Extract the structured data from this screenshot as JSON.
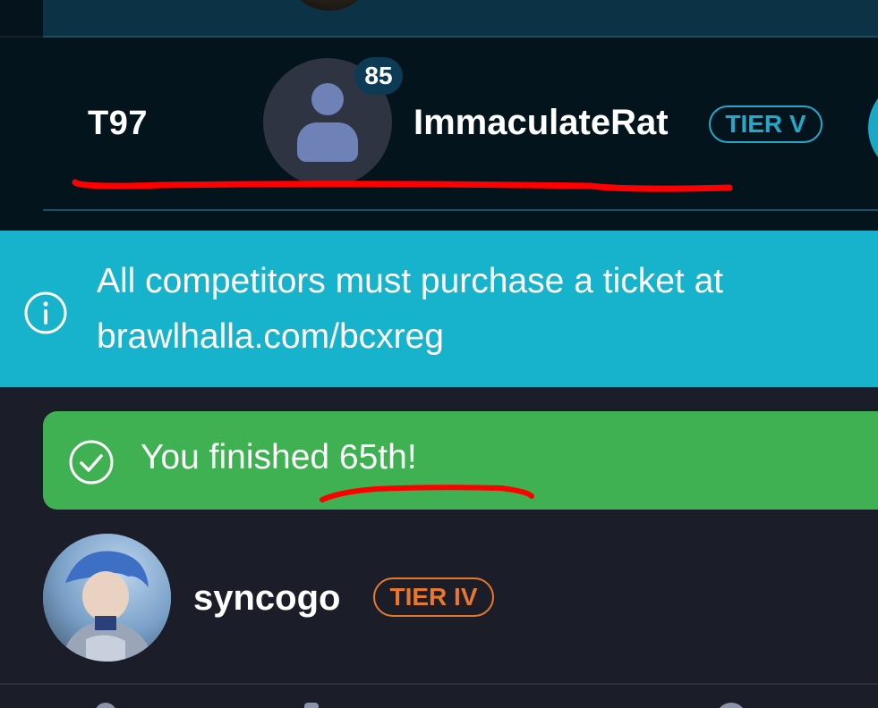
{
  "team_row": {
    "seed": "T97",
    "member_count": "85",
    "username": "ImmaculateRat",
    "tier": "TIER V"
  },
  "info_banner": {
    "icon": "info-icon",
    "message": "All competitors must purchase a ticket at brawlhalla.com/bcxreg"
  },
  "result_banner": {
    "icon": "check-circle-icon",
    "message": "You finished 65th!"
  },
  "user_row": {
    "username": "syncogo",
    "tier": "TIER IV"
  },
  "colors": {
    "info_banner": "#17b2cb",
    "result_banner": "#3fb152",
    "tier_v": "#25a7c9",
    "tier_iv": "#e8782d",
    "annotation": "#ff0000"
  }
}
